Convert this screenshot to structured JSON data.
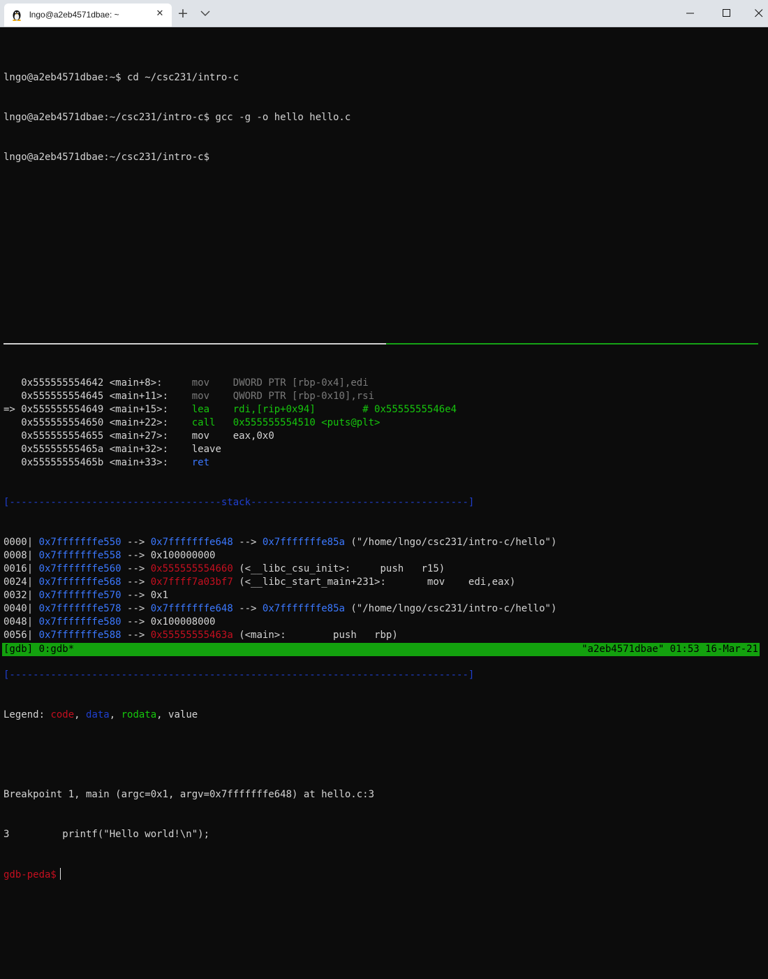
{
  "window": {
    "tab_title": "lngo@a2eb4571dbae: ~",
    "tab_icon": "linux-penguin-icon",
    "close_glyph": "✕",
    "new_tab_glyph": "+",
    "colors": {
      "titlebar": "#dfe3e8",
      "terminal_bg": "#0c0c0c",
      "status_bar": "#13a10e"
    }
  },
  "shell": {
    "lines": [
      "lngo@a2eb4571dbae:~$ cd ~/csc231/intro-c",
      "lngo@a2eb4571dbae:~/csc231/intro-c$ gcc -g -o hello hello.c",
      "lngo@a2eb4571dbae:~/csc231/intro-c$"
    ]
  },
  "gdb": {
    "code": [
      {
        "arrow": "  ",
        "addr": " 0x555555554642",
        "sym": " <main+8>:",
        "pad": "     ",
        "mnem": "mov",
        "gap": "    ",
        "ops": "DWORD PTR [rbp-0x4],edi",
        "comment": "",
        "style": "dim"
      },
      {
        "arrow": "  ",
        "addr": " 0x555555554645",
        "sym": " <main+11>:",
        "pad": "    ",
        "mnem": "mov",
        "gap": "    ",
        "ops": "QWORD PTR [rbp-0x10],rsi",
        "comment": "",
        "style": "dim"
      },
      {
        "arrow": "=>",
        "addr": " 0x555555554649",
        "sym": " <main+15>:",
        "pad": "    ",
        "mnem": "lea",
        "gap": "    ",
        "ops": "rdi,[rip+0x94]",
        "comment": "        # 0x5555555546e4",
        "style": "current"
      },
      {
        "arrow": "  ",
        "addr": " 0x555555554650",
        "sym": " <main+22>:",
        "pad": "    ",
        "mnem": "call",
        "gap": "   ",
        "ops": "0x555555554510 <puts@plt>",
        "comment": "",
        "style": "call"
      },
      {
        "arrow": "  ",
        "addr": " 0x555555554655",
        "sym": " <main+27>:",
        "pad": "    ",
        "mnem": "mov",
        "gap": "    ",
        "ops": "eax,0x0",
        "comment": "",
        "style": "normal"
      },
      {
        "arrow": "  ",
        "addr": " 0x55555555465a",
        "sym": " <main+32>:",
        "pad": "    ",
        "mnem": "leave",
        "gap": "",
        "ops": "",
        "comment": "",
        "style": "normal"
      },
      {
        "arrow": "  ",
        "addr": " 0x55555555465b",
        "sym": " <main+33>:",
        "pad": "    ",
        "mnem": "ret",
        "gap": "",
        "ops": "",
        "comment": "",
        "style": "ret"
      }
    ],
    "stack_header": "[------------------------------------stack-------------------------------------]",
    "stack": [
      {
        "off": "0000",
        "a1": "0x7fffffffe550",
        "a2": "0x7fffffffe648",
        "a2c": "data",
        "a3": "0x7fffffffe85a",
        "rest": " (\"/home/lngo/csc231/intro-c/hello\")"
      },
      {
        "off": "0008",
        "a1": "0x7fffffffe558",
        "a2": "0x100000000",
        "a2c": "value",
        "a3": "",
        "rest": ""
      },
      {
        "off": "0016",
        "a1": "0x7fffffffe560",
        "a2": "0x555555554660",
        "a2c": "code",
        "a3": "",
        "rest": " (<__libc_csu_init>:     push   r15)"
      },
      {
        "off": "0024",
        "a1": "0x7fffffffe568",
        "a2": "0x7ffff7a03bf7",
        "a2c": "code",
        "a3": "",
        "rest": " (<__libc_start_main+231>:       mov    edi,eax)"
      },
      {
        "off": "0032",
        "a1": "0x7fffffffe570",
        "a2": "0x1",
        "a2c": "value",
        "a3": "",
        "rest": ""
      },
      {
        "off": "0040",
        "a1": "0x7fffffffe578",
        "a2": "0x7fffffffe648",
        "a2c": "data",
        "a3": "0x7fffffffe85a",
        "rest": " (\"/home/lngo/csc231/intro-c/hello\")"
      },
      {
        "off": "0048",
        "a1": "0x7fffffffe580",
        "a2": "0x100008000",
        "a2c": "value",
        "a3": "",
        "rest": ""
      },
      {
        "off": "0056",
        "a1": "0x7fffffffe588",
        "a2": "0x55555555463a",
        "a2c": "code",
        "a3": "",
        "rest": " (<main>:        push   rbp)"
      }
    ],
    "stack_footer": "[------------------------------------------------------------------------------]",
    "legend": {
      "prefix": "Legend: ",
      "code": "code",
      "data": "data",
      "rodata": "rodata",
      "value": "value"
    },
    "breakpoint": "Breakpoint 1, main (argc=0x1, argv=0x7fffffffe648) at hello.c:3",
    "source_line": "3         printf(\"Hello world!\\n\");",
    "prompt": "gdb-peda$"
  },
  "status": {
    "left": "[gdb] 0:gdb*",
    "right": "\"a2eb4571dbae\" 01:53 16-Mar-21"
  }
}
